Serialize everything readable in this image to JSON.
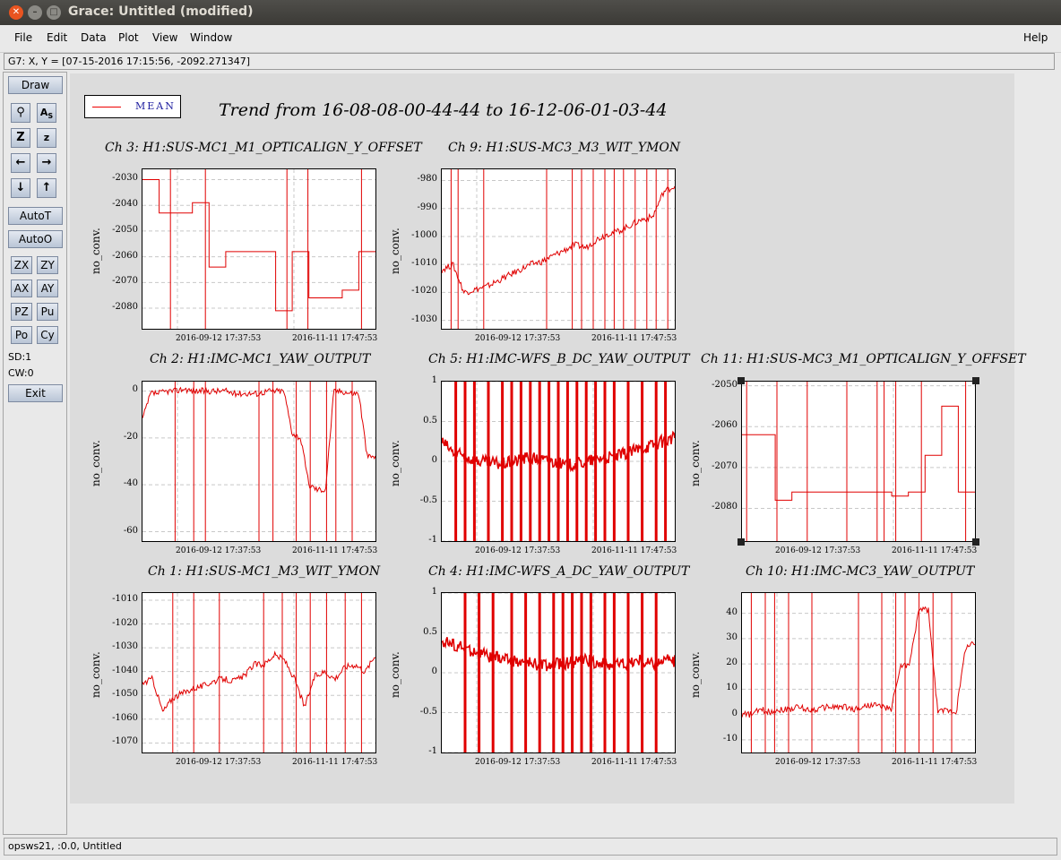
{
  "window": {
    "title": "Grace: Untitled (modified)"
  },
  "menu": {
    "file": "File",
    "edit": "Edit",
    "data": "Data",
    "plot": "Plot",
    "view": "View",
    "window": "Window",
    "help": "Help"
  },
  "locator": "G7: X, Y = [07-15-2016 17:15:56, -2092.271347]",
  "tools": {
    "draw": "Draw",
    "autot": "AutoT",
    "autoo": "AutoO",
    "zx": "ZX",
    "zy": "ZY",
    "ax": "AX",
    "ay": "AY",
    "pz": "PZ",
    "pu": "Pu",
    "po": "Po",
    "cy": "Cy",
    "sd": "SD:1",
    "cw": "CW:0",
    "exit": "Exit"
  },
  "legend": {
    "label": "MEAN"
  },
  "main_title": "Trend from 16-08-08-00-44-44 to 16-12-06-01-03-44",
  "status": "opsws21, :0.0, Untitled",
  "plots": [
    {
      "title": "Ch 3: H1:SUS-MC1_M1_OPTICALIGN_Y_OFFSET",
      "ylabel": "no_conv.",
      "yticks": [
        "-2030",
        "-2040",
        "-2050",
        "-2060",
        "-2070",
        "-2080"
      ],
      "xticks": [
        "2016-09-12 17:37:53",
        "2016-11-11 17:47:53"
      ]
    },
    {
      "title": "Ch 9: H1:SUS-MC3_M3_WIT_YMON",
      "ylabel": "no_conv.",
      "yticks": [
        "-980",
        "-990",
        "-1000",
        "-1010",
        "-1020",
        "-1030"
      ],
      "xticks": [
        "2016-09-12 17:37:53",
        "2016-11-11 17:47:53"
      ]
    },
    {
      "title": "Ch 2: H1:IMC-MC1_YAW_OUTPUT",
      "ylabel": "no_conv.",
      "yticks": [
        "0",
        "-20",
        "-40",
        "-60"
      ],
      "xticks": [
        "2016-09-12 17:37:53",
        "2016-11-11 17:47:53"
      ]
    },
    {
      "title": "Ch 5: H1:IMC-WFS_B_DC_YAW_OUTPUT",
      "ylabel": "no_conv.",
      "yticks": [
        "1",
        "0.5",
        "0",
        "-0.5",
        "-1"
      ],
      "xticks": [
        "2016-09-12 17:37:53",
        "2016-11-11 17:47:53"
      ]
    },
    {
      "title": "Ch 11: H1:SUS-MC3_M1_OPTICALIGN_Y_OFFSET",
      "ylabel": "no_conv.",
      "yticks": [
        "-2050",
        "-2060",
        "-2070",
        "-2080"
      ],
      "xticks": [
        "2016-09-12 17:37:53",
        "2016-11-11 17:47:53"
      ]
    },
    {
      "title": "Ch 1: H1:SUS-MC1_M3_WIT_YMON",
      "ylabel": "no_conv.",
      "yticks": [
        "-1010",
        "-1020",
        "-1030",
        "-1040",
        "-1050",
        "-1060",
        "-1070"
      ],
      "xticks": [
        "2016-09-12 17:37:53",
        "2016-11-11 17:47:53"
      ]
    },
    {
      "title": "Ch 4: H1:IMC-WFS_A_DC_YAW_OUTPUT",
      "ylabel": "no_conv.",
      "yticks": [
        "1",
        "0.5",
        "0",
        "-0.5",
        "-1"
      ],
      "xticks": [
        "2016-09-12 17:37:53",
        "2016-11-11 17:47:53"
      ]
    },
    {
      "title": "Ch 10: H1:IMC-MC3_YAW_OUTPUT",
      "ylabel": "no_conv.",
      "yticks": [
        "40",
        "30",
        "20",
        "10",
        "0",
        "-10"
      ],
      "xticks": [
        "2016-09-12 17:37:53",
        "2016-11-11 17:47:53"
      ]
    }
  ],
  "chart_data": [
    {
      "type": "line",
      "title": "Ch 3: H1:SUS-MC1_M1_OPTICALIGN_Y_OFFSET",
      "ylabel": "no_conv.",
      "ylim": [
        -2088,
        -2026
      ],
      "series": [
        {
          "name": "MEAN",
          "style": "step",
          "y": [
            -2030,
            -2043,
            -2043,
            -2039,
            -2064,
            -2058,
            -2058,
            -2058,
            -2081,
            -2058,
            -2076,
            -2076,
            -2073,
            -2058
          ]
        }
      ],
      "spikes": [
        0.12,
        0.27,
        0.62,
        0.71,
        0.94
      ]
    },
    {
      "type": "line",
      "title": "Ch 9: H1:SUS-MC3_M3_WIT_YMON",
      "ylabel": "no_conv.",
      "ylim": [
        -1033,
        -976
      ],
      "series": [
        {
          "name": "MEAN",
          "style": "noisy",
          "y": [
            -1012,
            -1010,
            -1020,
            -1019,
            -1018,
            -1016,
            -1014,
            -1012,
            -1010,
            -1009,
            -1007,
            -1005,
            -1003,
            -1004,
            -1001,
            -999,
            -998,
            -996,
            -994,
            -993,
            -984,
            -982
          ]
        }
      ],
      "spikes": [
        0.04,
        0.07,
        0.18,
        0.45,
        0.56,
        0.6,
        0.65,
        0.7,
        0.74,
        0.78,
        0.83,
        0.88,
        0.92,
        0.97
      ]
    },
    {
      "type": "line",
      "title": "Ch 2: H1:IMC-MC1_YAW_OUTPUT",
      "ylabel": "no_conv.",
      "ylim": [
        -64,
        4
      ],
      "series": [
        {
          "name": "MEAN",
          "style": "noisy",
          "y": [
            -12,
            -1,
            -1,
            0,
            0,
            1,
            0,
            0,
            0,
            0,
            0,
            -1,
            -1,
            -1,
            -1,
            0,
            0,
            0,
            -18,
            -20,
            -40,
            -42,
            -42,
            0,
            0,
            -1,
            -1,
            -28,
            -28
          ]
        }
      ],
      "spikes": [
        0.14,
        0.22,
        0.27,
        0.5,
        0.56,
        0.66,
        0.72,
        0.79,
        0.83,
        0.9
      ]
    },
    {
      "type": "line",
      "title": "Ch 5: H1:IMC-WFS_B_DC_YAW_OUTPUT",
      "ylabel": "no_conv.",
      "ylim": [
        -1,
        1
      ],
      "series": [
        {
          "name": "MEAN",
          "style": "dense",
          "y": [
            0.25,
            0.1,
            0.05,
            0,
            -0.02,
            -0.03,
            0,
            0.05,
            0.02,
            0.0,
            -0.05,
            -0.03,
            0.0,
            0.05,
            0.05,
            0.1,
            0.15,
            0.2,
            0.25,
            0.3
          ]
        }
      ],
      "spikes": [
        0.06,
        0.1,
        0.14,
        0.2,
        0.26,
        0.3,
        0.34,
        0.38,
        0.42,
        0.46,
        0.5,
        0.54,
        0.58,
        0.62,
        0.66,
        0.7,
        0.74,
        0.8,
        0.86,
        0.92,
        0.96
      ]
    },
    {
      "type": "line",
      "title": "Ch 11: H1:SUS-MC3_M1_OPTICALIGN_Y_OFFSET",
      "ylabel": "no_conv.",
      "ylim": [
        -2088,
        -2049
      ],
      "series": [
        {
          "name": "MEAN",
          "style": "step",
          "y": [
            -2062,
            -2062,
            -2078,
            -2076,
            -2076,
            -2076,
            -2076,
            -2076,
            -2076,
            -2077,
            -2076,
            -2067,
            -2055,
            -2076
          ]
        }
      ],
      "spikes": [
        0.02,
        0.15,
        0.28,
        0.45,
        0.58,
        0.61,
        0.66,
        0.77,
        0.96
      ]
    },
    {
      "type": "line",
      "title": "Ch 1: H1:SUS-MC1_M3_WIT_YMON",
      "ylabel": "no_conv.",
      "ylim": [
        -1074,
        -1007
      ],
      "series": [
        {
          "name": "MEAN",
          "style": "noisy",
          "y": [
            -1045,
            -1043,
            -1057,
            -1051,
            -1049,
            -1047,
            -1046,
            -1044,
            -1043,
            -1044,
            -1042,
            -1037,
            -1037,
            -1033,
            -1035,
            -1043,
            -1055,
            -1042,
            -1040,
            -1043,
            -1038,
            -1037,
            -1040,
            -1033
          ]
        }
      ],
      "spikes": [
        0.13,
        0.22,
        0.33,
        0.52,
        0.6,
        0.66,
        0.72,
        0.79,
        0.87,
        0.94
      ]
    },
    {
      "type": "line",
      "title": "Ch 4: H1:IMC-WFS_A_DC_YAW_OUTPUT",
      "ylabel": "no_conv.",
      "ylim": [
        -1,
        1
      ],
      "series": [
        {
          "name": "MEAN",
          "style": "dense",
          "y": [
            0.4,
            0.35,
            0.3,
            0.25,
            0.2,
            0.18,
            0.15,
            0.12,
            0.1,
            0.1,
            0.12,
            0.15,
            0.15,
            0.12,
            0.1,
            0.12,
            0.15,
            0.12,
            0.15,
            0.15
          ]
        }
      ],
      "spikes": [
        0.1,
        0.16,
        0.22,
        0.3,
        0.36,
        0.42,
        0.48,
        0.52,
        0.56,
        0.6,
        0.64,
        0.7,
        0.74,
        0.8,
        0.86,
        0.92
      ]
    },
    {
      "type": "line",
      "title": "Ch 10: H1:IMC-MC3_YAW_OUTPUT",
      "ylabel": "no_conv.",
      "ylim": [
        -15,
        48
      ],
      "series": [
        {
          "name": "MEAN",
          "style": "noisy",
          "y": [
            0,
            0,
            2,
            1,
            2,
            2,
            3,
            2,
            2,
            3,
            3,
            3,
            2,
            3,
            4,
            3,
            2,
            19,
            20,
            42,
            41,
            1,
            2,
            1,
            27,
            28
          ]
        }
      ],
      "spikes": [
        0.04,
        0.1,
        0.14,
        0.2,
        0.3,
        0.5,
        0.6,
        0.66,
        0.7,
        0.76,
        0.82,
        0.9
      ]
    }
  ]
}
